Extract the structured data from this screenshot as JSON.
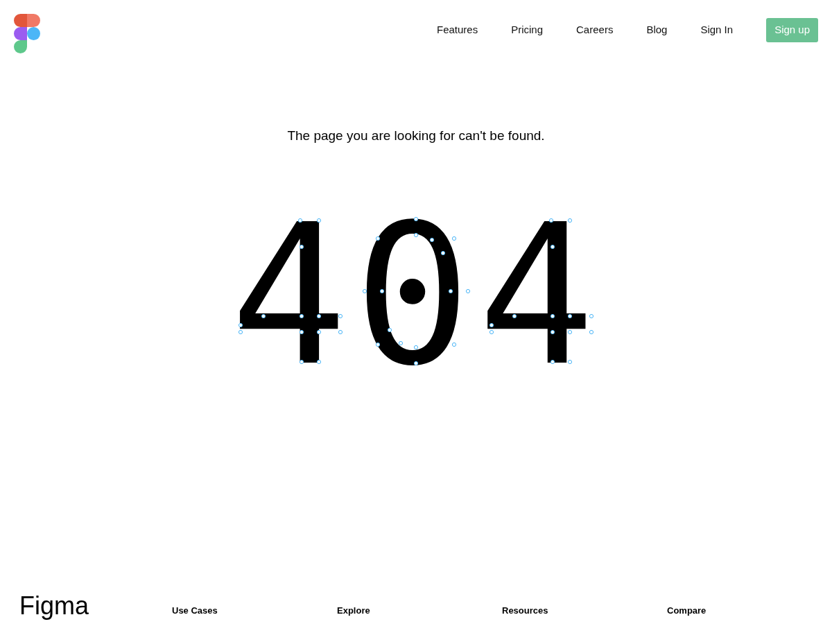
{
  "nav": {
    "links": [
      "Features",
      "Pricing",
      "Careers",
      "Blog",
      "Sign In"
    ],
    "signup": "Sign up"
  },
  "message": "The page you are looking for can't be found.",
  "error_code": "404",
  "footer": {
    "wordmark": "Figma",
    "columns": [
      "Use Cases",
      "Explore",
      "Resources",
      "Compare"
    ]
  }
}
